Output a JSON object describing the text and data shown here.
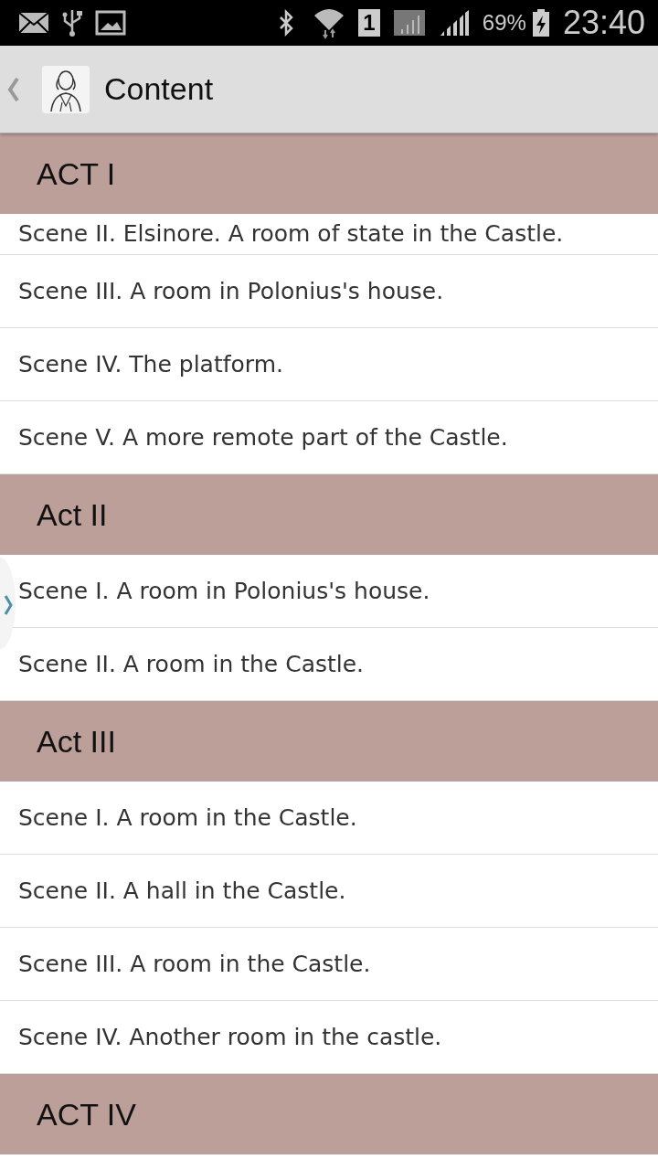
{
  "status_bar": {
    "sim_slot": "1",
    "battery": "69%",
    "time": "23:40"
  },
  "app_bar": {
    "title": "Content"
  },
  "acts": [
    {
      "title": "ACT I",
      "scenes": [
        "Scene II. Elsinore. A room of state in the Castle.",
        "Scene III. A room in Polonius's house.",
        "Scene IV. The platform.",
        "Scene V. A more remote part of the Castle."
      ]
    },
    {
      "title": "Act II",
      "scenes": [
        "Scene I. A room in Polonius's house.",
        "Scene II. A room in the Castle."
      ]
    },
    {
      "title": "Act III",
      "scenes": [
        "Scene I. A room in the Castle.",
        "Scene II. A hall in the Castle.",
        "Scene III. A room in the Castle.",
        "Scene IV. Another room in the castle."
      ]
    },
    {
      "title": "ACT IV"
    }
  ]
}
